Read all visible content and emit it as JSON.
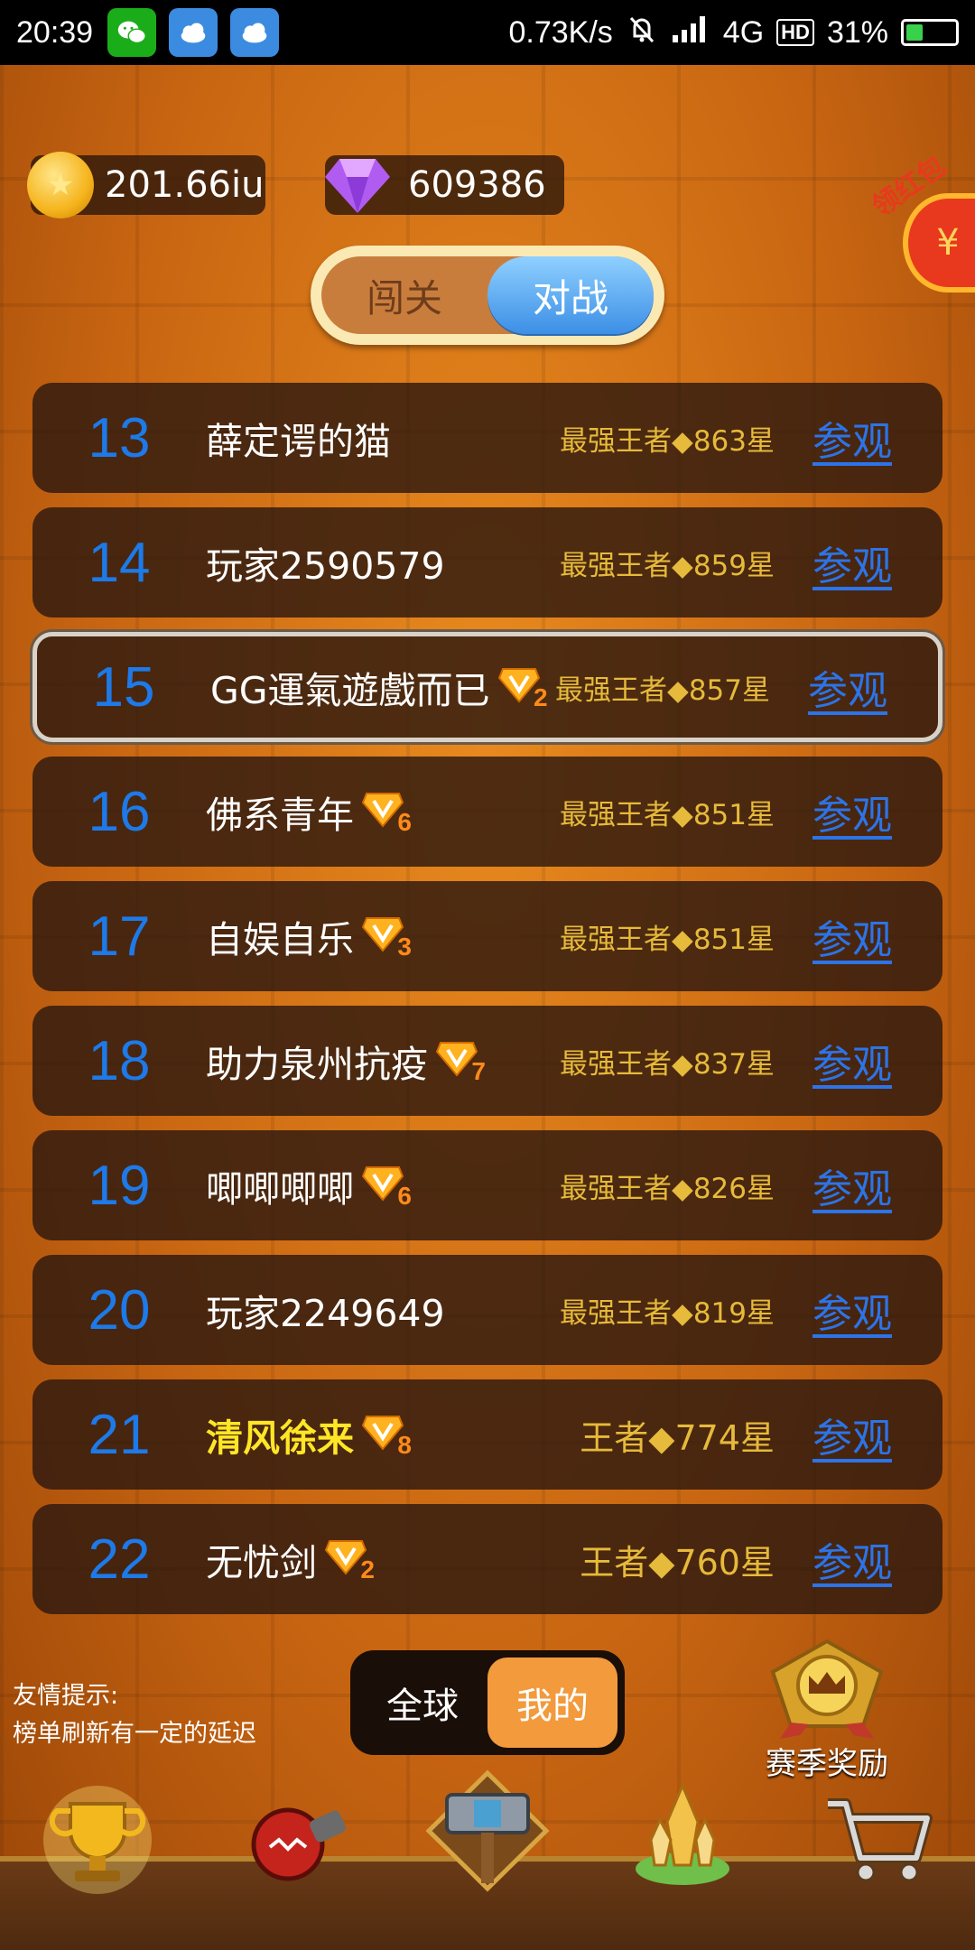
{
  "status_bar": {
    "time": "20:39",
    "speed": "0.73K/s",
    "network": "4G",
    "signal_label": "4G",
    "hd": "HD",
    "battery": "31%",
    "battery_level": 0.31,
    "app_icons": [
      "wechat-icon",
      "weather-icon",
      "weather-icon"
    ]
  },
  "currency": {
    "gold": "201.66iu",
    "gems": "609386"
  },
  "red_packet": {
    "label": "领红包",
    "symbol": "¥"
  },
  "mode_tabs": [
    {
      "label": "闯关",
      "active": false
    },
    {
      "label": "对战",
      "active": true
    }
  ],
  "rankings": [
    {
      "rank": "13",
      "name": "薛定谔的猫",
      "vip": "",
      "level": "最强王者◆863星",
      "watch": "参观"
    },
    {
      "rank": "14",
      "name": "玩家2590579",
      "vip": "",
      "level": "最强王者◆859星",
      "watch": "参观"
    },
    {
      "rank": "15",
      "name": "GG運氣遊戲而已",
      "vip": "2",
      "level": "最强王者◆857星",
      "watch": "参观"
    },
    {
      "rank": "16",
      "name": "佛系青年",
      "vip": "6",
      "level": "最强王者◆851星",
      "watch": "参观"
    },
    {
      "rank": "17",
      "name": "自娱自乐",
      "vip": "3",
      "level": "最强王者◆851星",
      "watch": "参观"
    },
    {
      "rank": "18",
      "name": "助力泉州抗疫",
      "vip": "7",
      "level": "最强王者◆837星",
      "watch": "参观"
    },
    {
      "rank": "19",
      "name": "唧唧唧唧",
      "vip": "6",
      "level": "最强王者◆826星",
      "watch": "参观"
    },
    {
      "rank": "20",
      "name": "玩家2249649",
      "vip": "",
      "level": "最强王者◆819星",
      "watch": "参观"
    },
    {
      "rank": "21",
      "name": "清风徐来",
      "vip": "8",
      "level": "王者◆774星",
      "watch": "参观"
    },
    {
      "rank": "22",
      "name": "无忧剑",
      "vip": "2",
      "level": "王者◆760星",
      "watch": "参观"
    }
  ],
  "tip": {
    "line1": "友情提示:",
    "line2": "榜单刷新有一定的延迟"
  },
  "scope_tabs": [
    {
      "label": "全球",
      "active": false
    },
    {
      "label": "我的",
      "active": true
    }
  ],
  "season_reward": {
    "label": "赛季奖励",
    "icon": "crown-medal-icon"
  },
  "bottom_nav": [
    {
      "label": "排行",
      "icon": "trophy-icon",
      "active": false
    },
    {
      "label": "强化",
      "icon": "upgrade-icon",
      "active": false
    },
    {
      "label": "战场",
      "icon": "hammer-icon",
      "active": true
    },
    {
      "label": "历练",
      "icon": "crystal-icon",
      "active": false
    },
    {
      "label": "商店",
      "icon": "cart-icon",
      "active": false
    }
  ],
  "colors": {
    "rank_number": "#1d7ae8",
    "level_text": "#e6ba3a",
    "watch_link": "#2c74e8",
    "self_name": "#ffe626",
    "active_scope": "#f29a3c",
    "active_mode": "#3c8fe6"
  }
}
